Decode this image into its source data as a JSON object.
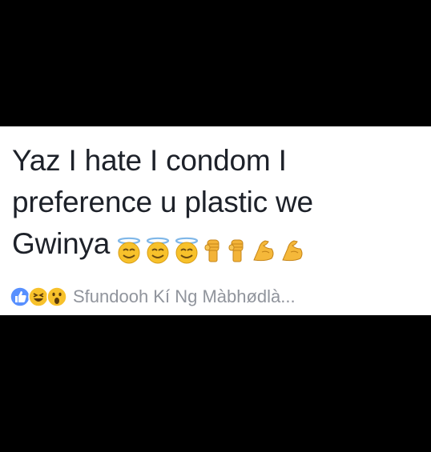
{
  "post": {
    "lines": [
      "Yaz I hate I condom I",
      "preference u plastic we",
      "Gwinya"
    ],
    "emojis": [
      "smiling-face-with-halo-icon",
      "smiling-face-with-halo-icon",
      "smiling-face-with-halo-icon",
      "raised-fist-icon",
      "raised-fist-icon",
      "flexed-biceps-icon",
      "flexed-biceps-icon"
    ]
  },
  "reactions": {
    "icons": [
      "like-reaction-icon",
      "haha-reaction-icon",
      "wow-reaction-icon"
    ],
    "names_text": "Sfundooh Kí Ng Màbhødlà..."
  },
  "colors": {
    "background": "#000000",
    "card": "#ffffff",
    "text": "#1d2129",
    "meta_text": "#90949c",
    "like_blue": "#5890ff",
    "emoji_yellow": "#f7c12b"
  }
}
